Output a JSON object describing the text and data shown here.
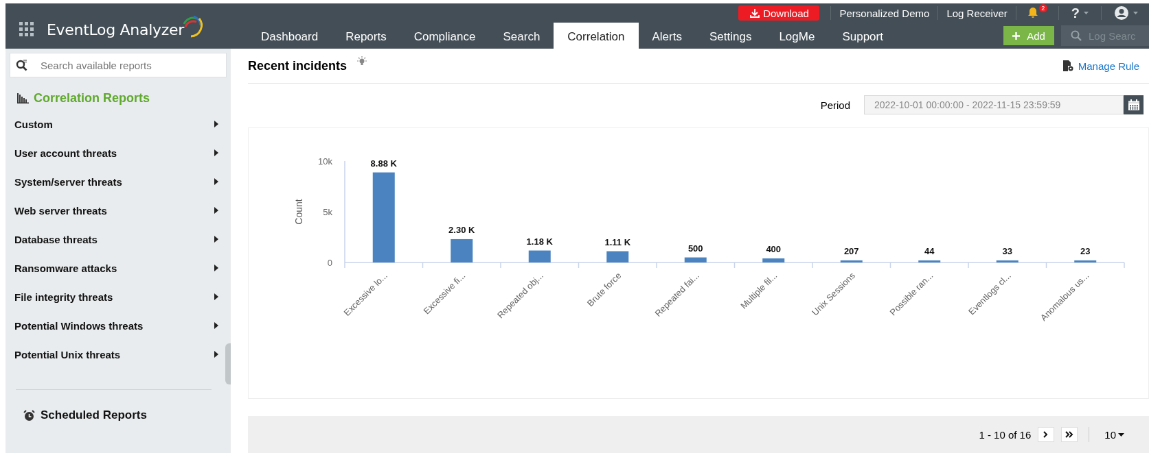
{
  "header": {
    "logo_text": "EventLog Analyzer",
    "download_label": "Download",
    "top_links": [
      "Personalized Demo",
      "Log Receiver"
    ],
    "notification_count": "2",
    "help_label": "?",
    "nav_tabs": [
      {
        "label": "Dashboard",
        "selected": false
      },
      {
        "label": "Reports",
        "selected": false
      },
      {
        "label": "Compliance",
        "selected": false
      },
      {
        "label": "Search",
        "selected": false
      },
      {
        "label": "Correlation",
        "selected": true
      },
      {
        "label": "Alerts",
        "selected": false
      },
      {
        "label": "Settings",
        "selected": false
      },
      {
        "label": "LogMe",
        "selected": false
      },
      {
        "label": "Support",
        "selected": false
      }
    ],
    "add_label": "Add",
    "search_placeholder": "Log Searc"
  },
  "sidebar": {
    "search_placeholder": "Search available reports",
    "section_title": "Correlation Reports",
    "items": [
      {
        "label": "Custom"
      },
      {
        "label": "User account threats"
      },
      {
        "label": "System/server threats"
      },
      {
        "label": "Web server threats"
      },
      {
        "label": "Database threats"
      },
      {
        "label": "Ransomware attacks"
      },
      {
        "label": "File integrity threats"
      },
      {
        "label": "Potential Windows threats"
      },
      {
        "label": "Potential Unix threats"
      }
    ],
    "scheduled_label": "Scheduled Reports"
  },
  "main": {
    "title": "Recent incidents",
    "manage_rule": "Manage Rule",
    "period_label": "Period",
    "period_value": "2022-10-01 00:00:00 - 2022-11-15 23:59:59",
    "chart_data": {
      "type": "bar",
      "ylabel": "Count",
      "categories": [
        "Excessive lo...",
        "Excessive fi...",
        "Repeated obj...",
        "Brute force",
        "Repeated fai...",
        "Multiple fil...",
        "Unix Sessions",
        "Possible ran...",
        "Eventlogs cl...",
        "Anomalous us..."
      ],
      "values": [
        8880,
        2300,
        1180,
        1110,
        500,
        400,
        207,
        44,
        33,
        23
      ],
      "value_labels": [
        "8.88 K",
        "2.30 K",
        "1.18 K",
        "1.11 K",
        "500",
        "400",
        "207",
        "44",
        "33",
        "23"
      ],
      "ylim": [
        0,
        10000
      ],
      "yticks": [
        0,
        {
          "value": 5000,
          "label": "5k"
        },
        {
          "value": 10000,
          "label": "10k"
        }
      ]
    },
    "pager": {
      "range": "1 - 10 of 16",
      "page_size": "10"
    }
  }
}
